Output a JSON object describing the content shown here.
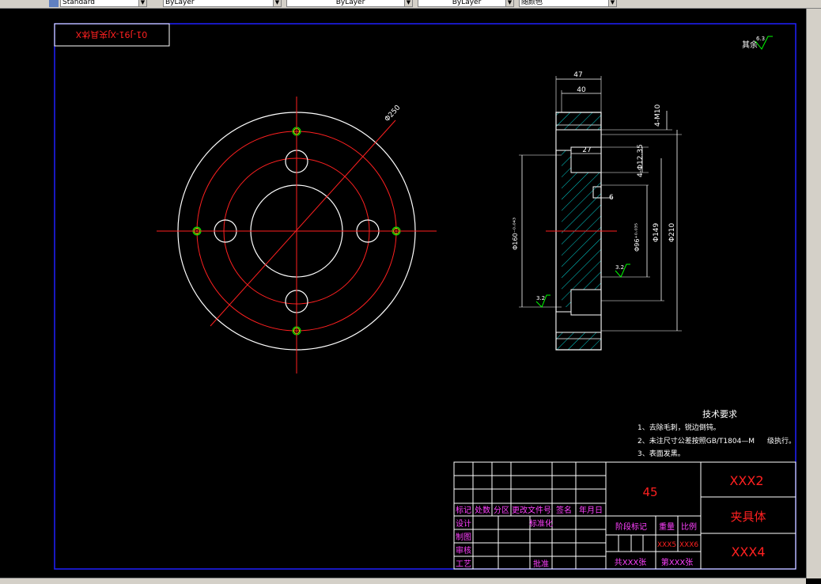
{
  "toolbar": {
    "text_style": "Standard",
    "layer_color": "ByLayer",
    "linetype": "ByLayer",
    "lineweight": "ByLayer",
    "plot_style": "随颜色"
  },
  "drawing": {
    "title_mirror": "01-J91-XJ夹具体X",
    "roughness_general": "其余",
    "roughness_general_value": "6.3",
    "front_view": {
      "dim_diameter_250": "Φ250"
    },
    "section_view": {
      "dim_47": "47",
      "dim_40": "40",
      "dim_4m10": "4-M10",
      "dim_27": "27",
      "dim_4holes": "4-Φ12.35",
      "dim_6": "6",
      "dim_160": "Φ160⁻⁰·⁰⁴³",
      "dim_96": "Φ96⁺⁰·⁰³⁵",
      "dim_149": "Φ149",
      "dim_210": "Φ210",
      "roughness_1": "3.2",
      "roughness_2": "3.2"
    },
    "tech_requirements": {
      "heading": "技术要求",
      "line1": "1、去除毛刺，锐边倒钝。",
      "line2": "2、未注尺寸公差按照GB/T1804—M",
      "line2b": "级执行。",
      "line3": "3、表面发黑。"
    },
    "title_block": {
      "material": "45",
      "drawing_no": "XXX2",
      "part_name": "夹具体",
      "company": "XXX4",
      "headers": [
        "标记",
        "处数",
        "分区",
        "更改文件号",
        "签名",
        "年月日"
      ],
      "design": "设计",
      "standardize": "标准化",
      "draw": "制图",
      "check": "审核",
      "process": "工艺",
      "approve": "批准",
      "stage_mark": "阶段标记",
      "weight": "重量",
      "scale": "比例",
      "weight_value": "XXX5",
      "scale_value": "XXX6",
      "sheets_total": "共XXX张",
      "sheet_no": "第XXX张"
    }
  }
}
